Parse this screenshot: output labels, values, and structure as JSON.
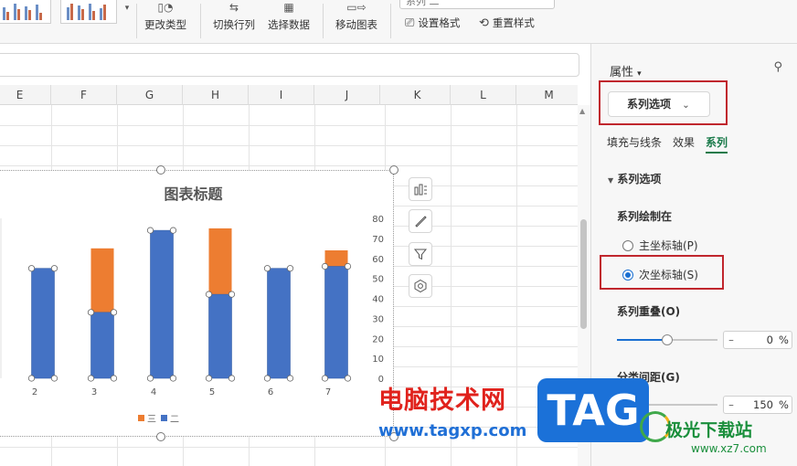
{
  "ribbon": {
    "buttons": [
      {
        "label": "更改类型",
        "icon": "chart-type-icon"
      },
      {
        "label": "切换行列",
        "icon": "switch-row-col-icon"
      },
      {
        "label": "选择数据",
        "icon": "select-data-icon"
      },
      {
        "label": "移动图表",
        "icon": "move-chart-icon"
      }
    ],
    "series_select": "系列 二",
    "set_format": "设置格式",
    "reset_style": "重置样式"
  },
  "sheet": {
    "columns": [
      "E",
      "F",
      "G",
      "H",
      "I",
      "J",
      "K",
      "L",
      "M"
    ]
  },
  "chart_data": {
    "type": "bar",
    "title": "图表标题",
    "categories": [
      "2",
      "3",
      "4",
      "5",
      "6",
      "7"
    ],
    "series": [
      {
        "name": "三",
        "color": "#ED7D31",
        "values": [
          55,
          65,
          74,
          75,
          55,
          64
        ]
      },
      {
        "name": "二",
        "color": "#4472C4",
        "values": [
          55,
          33,
          74,
          42,
          55,
          56
        ]
      }
    ],
    "y2_ticks": [
      "0",
      "10",
      "20",
      "30",
      "40",
      "50",
      "60",
      "70",
      "80"
    ],
    "y2lim": [
      0,
      80
    ],
    "legend": "bottom",
    "grid": false
  },
  "panel": {
    "title": "属性",
    "dropdown": "系列选项",
    "tabs": [
      "填充与线条",
      "效果",
      "系列"
    ],
    "active_tab": "系列",
    "section": "系列选项",
    "plot_on_label": "系列绘制在",
    "radio_primary": "主坐标轴(P)",
    "radio_secondary": "次坐标轴(S)",
    "selected_axis": "secondary",
    "overlap_label": "系列重叠(O)",
    "overlap_value": "0",
    "overlap_fraction": 0.5,
    "gap_label": "分类间距(G)",
    "gap_value": "150",
    "unit": "%",
    "minus": "–"
  },
  "watermark": {
    "site_cn": "电脑技术网",
    "site_url": "www.tagxp.com",
    "badge": "TAG",
    "brand2": "极光下载站",
    "brand2_url": "www.xz7.com"
  }
}
